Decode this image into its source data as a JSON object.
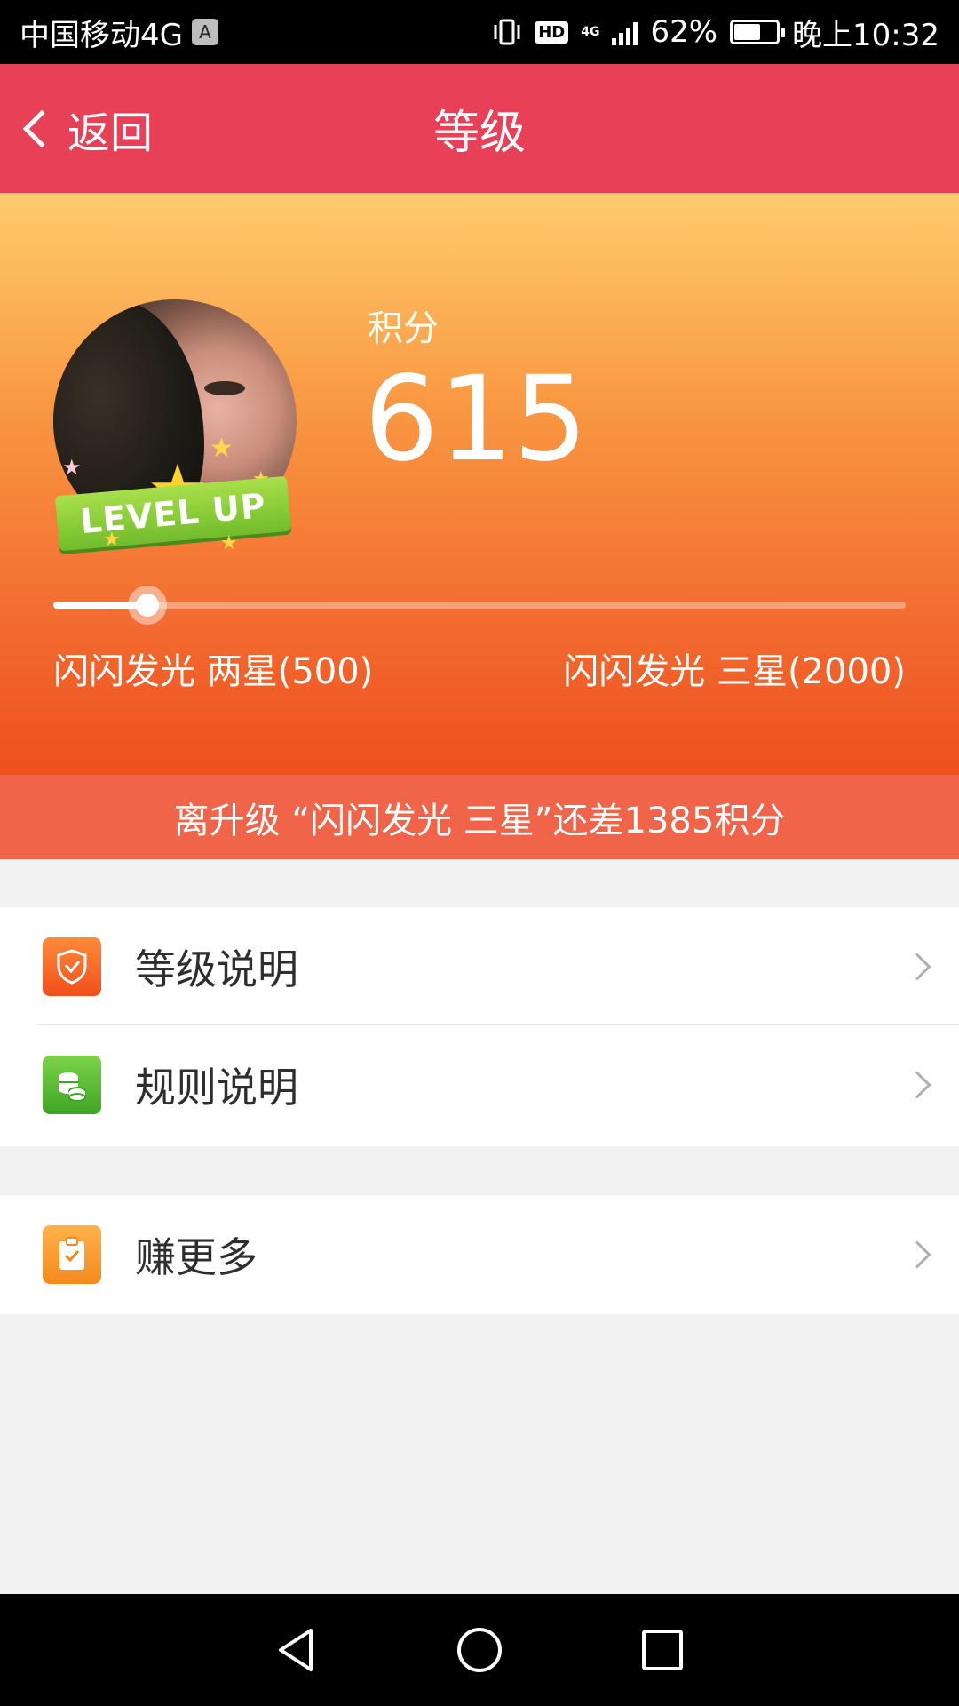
{
  "status_bar": {
    "carrier": "中国移动4G",
    "sim_badge": "A",
    "hd": "HD",
    "network": "4G",
    "battery_percent": "62%",
    "battery_level": 0.62,
    "time": "晚上10:32"
  },
  "nav": {
    "back_label": "返回",
    "title": "等级"
  },
  "hero": {
    "score_label": "积分",
    "score_value": "615",
    "avatar_badge": "LEVEL UP",
    "progress_fraction": 0.11,
    "current_level": "闪闪发光 两星(500)",
    "next_level": "闪闪发光 三星(2000)"
  },
  "upgrade_banner": "离升级 “闪闪发光 三星”还差1385积分",
  "menu": {
    "level_info": "等级说明",
    "rules_info": "规则说明",
    "earn_more": "赚更多"
  },
  "colors": {
    "nav_bar": "#e84157",
    "banner": "#f0644a",
    "hero_top": "#ffcc6e",
    "hero_bottom": "#ee4f1d"
  }
}
